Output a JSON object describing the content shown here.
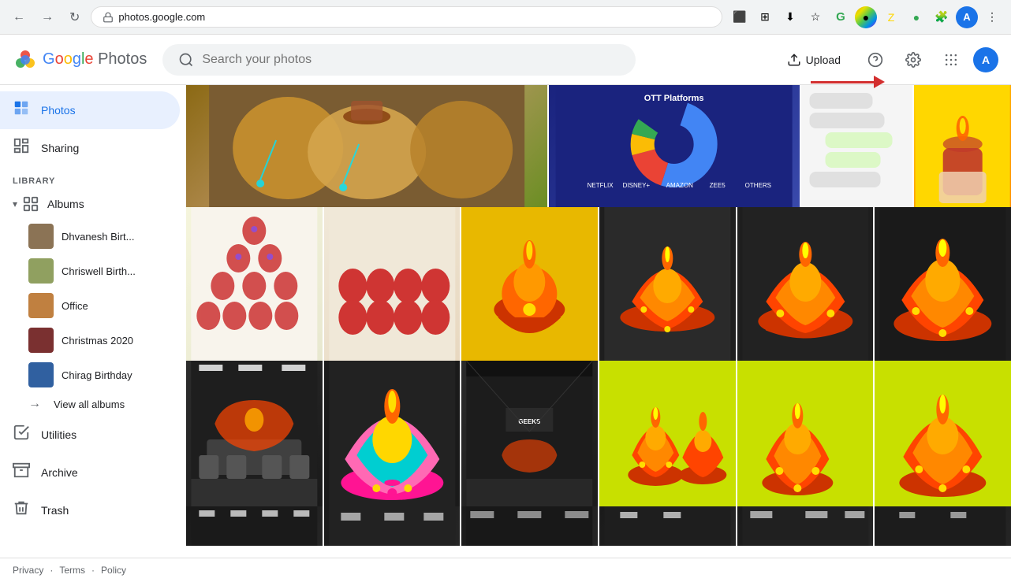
{
  "browser": {
    "url": "photos.google.com",
    "back_btn": "←",
    "forward_btn": "→",
    "reload_btn": "↻"
  },
  "header": {
    "logo_google": "Google",
    "logo_photos": "Photos",
    "search_placeholder": "Search your photos",
    "upload_label": "Upload",
    "help_icon": "?",
    "settings_icon": "⚙",
    "apps_icon": "⠿",
    "user_initial": "A"
  },
  "sidebar": {
    "library_label": "LIBRARY",
    "photos_label": "Photos",
    "sharing_label": "Sharing",
    "albums_label": "Albums",
    "albums": [
      {
        "name": "Dhvanesh Birt...",
        "color": "#8B7355"
      },
      {
        "name": "Chriswell Birth...",
        "color": "#A0B090"
      },
      {
        "name": "Office",
        "color": "#C08040"
      },
      {
        "name": "Christmas 2020",
        "color": "#704040"
      },
      {
        "name": "Chirag Birthday",
        "color": "#406080"
      }
    ],
    "view_all_albums": "View all albums",
    "utilities_label": "Utilities",
    "archive_label": "Archive",
    "trash_label": "Trash"
  },
  "footer": {
    "privacy": "Privacy",
    "terms": "Terms",
    "policy": "Policy"
  },
  "annotation": {
    "arrow_points_to": "Upload button"
  }
}
